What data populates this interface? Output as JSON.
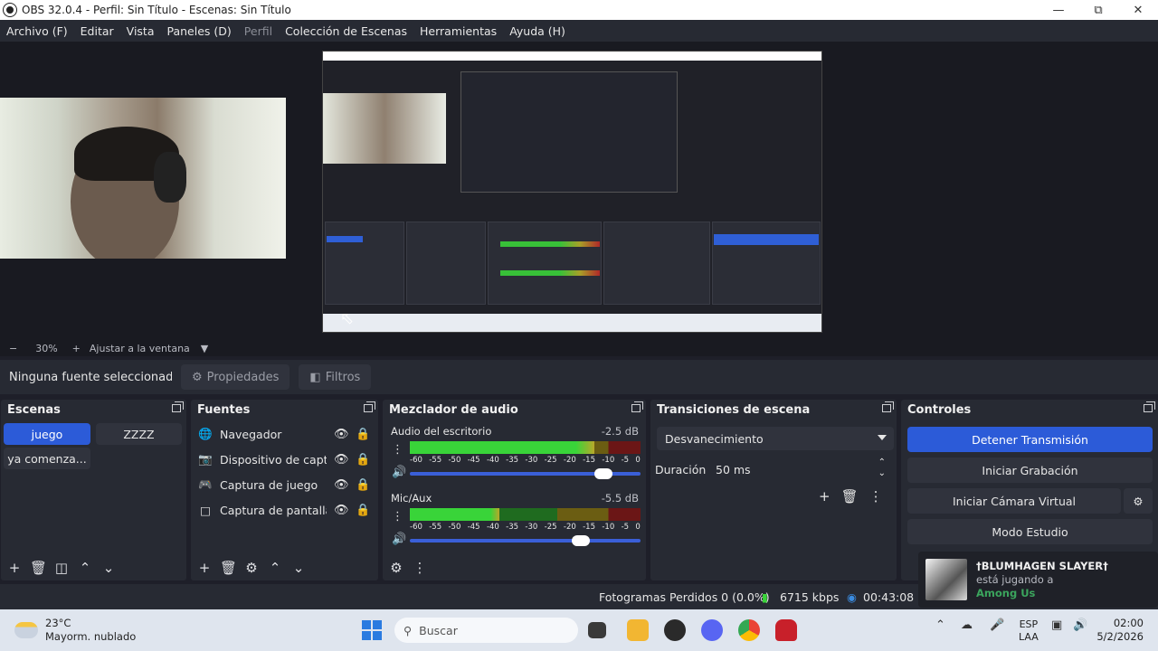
{
  "window": {
    "title": "OBS 32.0.4 - Perfil: Sin Título - Escenas: Sin Título"
  },
  "menu": [
    {
      "label": "Archivo (F)",
      "disabled": false
    },
    {
      "label": "Editar",
      "disabled": false
    },
    {
      "label": "Vista",
      "disabled": false
    },
    {
      "label": "Paneles (D)",
      "disabled": false
    },
    {
      "label": "Perfil",
      "disabled": true
    },
    {
      "label": "Colección de Escenas",
      "disabled": false
    },
    {
      "label": "Herramientas",
      "disabled": false
    },
    {
      "label": "Ayuda (H)",
      "disabled": false
    }
  ],
  "zoom": {
    "minus": "−",
    "value": "30%",
    "plus": "+",
    "fit_label": "Ajustar a la ventana"
  },
  "source_toolbar": {
    "no_selection": "Ninguna fuente seleccionad",
    "properties": "Propiedades",
    "filters": "Filtros"
  },
  "scenes": {
    "title": "Escenas",
    "items": [
      {
        "label": "juego",
        "active": true
      },
      {
        "label": "ZZZZ",
        "active": false
      },
      {
        "label": "ya comenza...",
        "active": false
      }
    ]
  },
  "sources": {
    "title": "Fuentes",
    "items": [
      {
        "label": "Navegador",
        "icon": "globe-icon"
      },
      {
        "label": "Dispositivo de captura",
        "icon": "camera-icon"
      },
      {
        "label": "Captura de juego",
        "icon": "gamepad-icon"
      },
      {
        "label": "Captura de pantalla",
        "icon": "monitor-icon"
      }
    ]
  },
  "mixer": {
    "title": "Mezclador de audio",
    "scale": [
      "-60",
      "-55",
      "-50",
      "-45",
      "-40",
      "-35",
      "-30",
      "-25",
      "-20",
      "-15",
      "-10",
      "-5",
      "0"
    ],
    "channels": [
      {
        "name": "Audio del escritorio",
        "db": "-2.5 dB",
        "level": 0.8,
        "volume": 0.84
      },
      {
        "name": "Mic/Aux",
        "db": "-5.5 dB",
        "level": 0.39,
        "volume": 0.74
      }
    ]
  },
  "transitions": {
    "title": "Transiciones de escena",
    "selected": "Desvanecimiento",
    "duration_label": "Duración",
    "duration_value": "50 ms"
  },
  "controls": {
    "title": "Controles",
    "buttons": [
      "Detener Transmisión",
      "Iniciar Grabación",
      "Iniciar Cámara Virtual",
      "Modo Estudio"
    ]
  },
  "status": {
    "dropped_frames": "Fotogramas Perdidos 0 (0.0%)",
    "bitrate": "6715 kbps",
    "time": "00:43:08"
  },
  "notification": {
    "name": "†BLUMHAGEN SLAYER†",
    "line1": "está jugando a",
    "game": "Among Us"
  },
  "taskbar": {
    "temperature": "23°C",
    "weather": "Mayorm. nublado",
    "search_placeholder": "Buscar",
    "lang1": "ESP",
    "lang2": "LAA",
    "time": "02:00",
    "date": "5/2/2026"
  },
  "colors": {
    "accent": "#2c5bd8",
    "panel": "#272a33",
    "background": "#1e1f29"
  }
}
